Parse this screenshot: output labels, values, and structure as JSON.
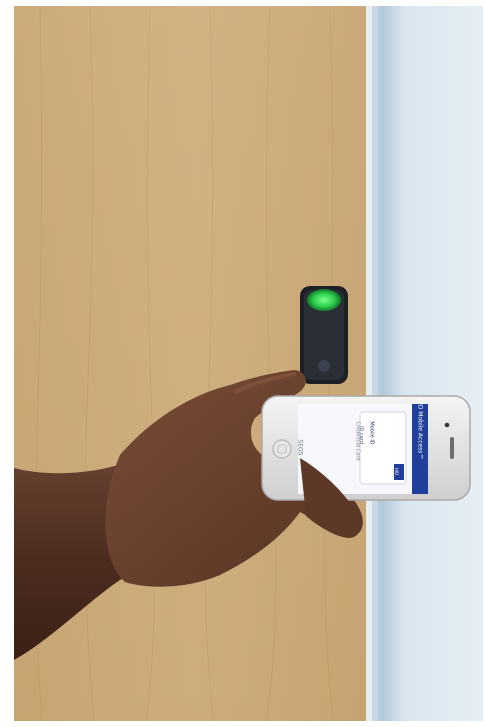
{
  "scene": {
    "description_tags": [
      "wooden-door",
      "access-reader",
      "hand",
      "smartphone"
    ],
    "reader_light_color": "#26c84a",
    "app_bar_color": "#1f3f9a"
  },
  "phone_screen": {
    "app_title": "HID Mobile Access™",
    "card_label": "Mobile ID",
    "card_detail": "ID card",
    "card_sub": "Credential Card",
    "footer_text": "SEOS",
    "brand_badge": "HID"
  }
}
